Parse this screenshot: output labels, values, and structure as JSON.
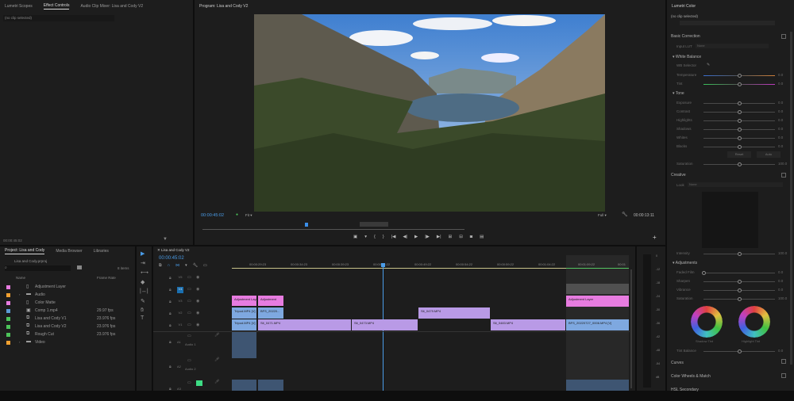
{
  "left_panel": {
    "tabs": [
      "Lumetri Scopes",
      "Effect Controls",
      "Audio Clip Mixer: Lisa and Cody V2"
    ],
    "active_tab": "Effect Controls",
    "clip_dropdown": "(no clip selected)",
    "timecode": "00:00:45:02"
  },
  "program": {
    "title": "Program: Lisa and Cody V2",
    "timecode": "00:00:45:02",
    "zoom": "Fit",
    "quality": "Full",
    "duration": "00:00:13:11"
  },
  "project": {
    "tabs": [
      "Project: Lisa and Cody",
      "Media Browser",
      "Libraries"
    ],
    "file": "Lisa and Cody.prproj",
    "item_count": "8 items",
    "col_name": "Name",
    "col_fps": "Frame Rate",
    "items": [
      {
        "name": "Adjustment Layer",
        "fps": "",
        "color": "#e77ce0",
        "icon": "file"
      },
      {
        "name": "Audio",
        "fps": "",
        "color": "#f0a030",
        "icon": "folder"
      },
      {
        "name": "Color Matte",
        "fps": "",
        "color": "#e77ce0",
        "icon": "file"
      },
      {
        "name": "Comp 1.mp4",
        "fps": "29.97 fps",
        "color": "#5b9bd5",
        "icon": "clip"
      },
      {
        "name": "Lisa and Cody V1",
        "fps": "23.976 fps",
        "color": "#4cc35a",
        "icon": "sequence"
      },
      {
        "name": "Lisa and Cody V2",
        "fps": "23.976 fps",
        "color": "#4cc35a",
        "icon": "sequence"
      },
      {
        "name": "Rough Cut",
        "fps": "23.976 fps",
        "color": "#4cc35a",
        "icon": "sequence"
      },
      {
        "name": "Video",
        "fps": "",
        "color": "#f0a030",
        "icon": "folder"
      }
    ]
  },
  "timeline": {
    "title": "Lisa and Cody V2",
    "timecode": "00:00:45:02",
    "ruler": [
      "00:00:29:23",
      "00:00:34:23",
      "00:00:39:23",
      "00:00:44:22",
      "00:00:49:22",
      "00:00:54:22",
      "00:00:59:22",
      "00:01:04:22",
      "00:01:09:22",
      "00:01"
    ],
    "tracks": {
      "v": [
        "V6",
        "V5",
        "V4",
        "V3",
        "V2",
        "V1"
      ],
      "a": [
        "A1",
        "A2",
        "A3"
      ],
      "audio1": "Audio 1",
      "audio2": "Audio 2"
    },
    "clips": {
      "adj1": "Adjustment Layer",
      "adj2": "Adjustment",
      "adj3": "Adjustment Layer",
      "tripod1": "Tripod.MP4 [V]",
      "bfs": "BFS_20220...",
      "sit479": "Sit_0479.MP4",
      "tripod2": "Tripod.MP4 [V]",
      "sit471": "Sit_0471.MP4",
      "sit473": "Sit_0473.MP4",
      "sit483": "Sit_0483.MP4",
      "bfs2": "BFS_20220727_0006.MP4 [V]"
    },
    "meter": [
      "0",
      "-12",
      "-18",
      "-24",
      "-30",
      "-36",
      "-42",
      "-48",
      "-54",
      "dB"
    ]
  },
  "lumetri": {
    "title": "Lumetri Color",
    "clip": "(no clip selected)",
    "basic": "Basic Correction",
    "input_lut": "Input LUT",
    "lut_val": "None",
    "wb": "White Balance",
    "wb_selector": "WB Selector",
    "wb_sliders": [
      {
        "label": "Temperature",
        "value": "0.0"
      },
      {
        "label": "Tint",
        "value": "0.0"
      }
    ],
    "tone": "Tone",
    "tone_sliders": [
      {
        "label": "Exposure",
        "value": "0.0"
      },
      {
        "label": "Contrast",
        "value": "0.0"
      },
      {
        "label": "Highlights",
        "value": "0.0"
      },
      {
        "label": "Shadows",
        "value": "0.0"
      },
      {
        "label": "Whites",
        "value": "0.0"
      },
      {
        "label": "Blacks",
        "value": "0.0"
      }
    ],
    "reset": "Reset",
    "auto": "Auto",
    "saturation": {
      "label": "Saturation",
      "value": "100.0"
    },
    "creative": "Creative",
    "look": "Look",
    "look_val": "None",
    "intensity": {
      "label": "Intensity",
      "value": "100.0"
    },
    "adjustments": "Adjustments",
    "adj_sliders": [
      {
        "label": "Faded Film",
        "value": "0.0"
      },
      {
        "label": "Sharpen",
        "value": "0.0"
      },
      {
        "label": "Vibrance",
        "value": "0.0"
      },
      {
        "label": "Saturation",
        "value": "100.0"
      }
    ],
    "shadow_tint": "Shadow Tint",
    "highlight_tint": "Highlight Tint",
    "tint_balance": {
      "label": "Tint Balance",
      "value": "0.0"
    },
    "curves": "Curves",
    "wheels": "Color Wheels & Match",
    "hsl": "HSL Secondary"
  }
}
